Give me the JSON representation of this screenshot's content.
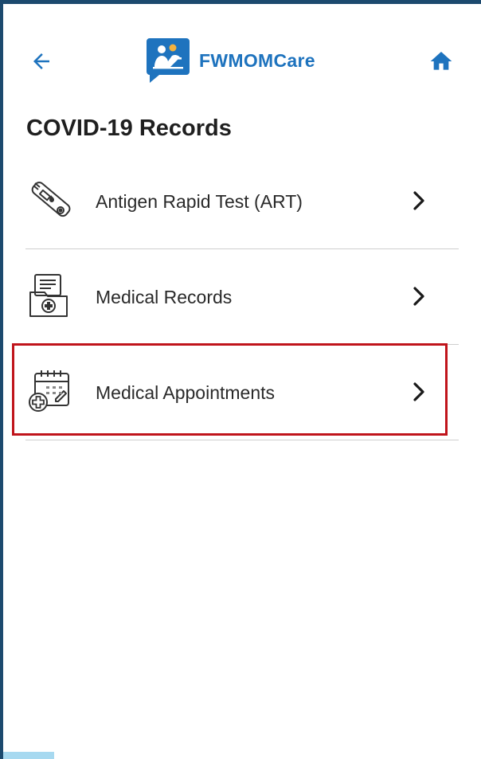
{
  "app": {
    "brand_name": "FWMOMCare"
  },
  "header": {
    "back_icon": "arrow-left-icon",
    "home_icon": "home-icon"
  },
  "page": {
    "title": "COVID-19 Records"
  },
  "records": [
    {
      "label": "Antigen Rapid Test (ART)",
      "icon": "antigen-test-kit-icon"
    },
    {
      "label": "Medical Records",
      "icon": "medical-folder-icon"
    },
    {
      "label": "Medical Appointments",
      "icon": "calendar-medical-icon"
    }
  ],
  "colors": {
    "brand": "#1e73be",
    "frame": "#1c4a6e",
    "highlight": "#c0141b"
  }
}
